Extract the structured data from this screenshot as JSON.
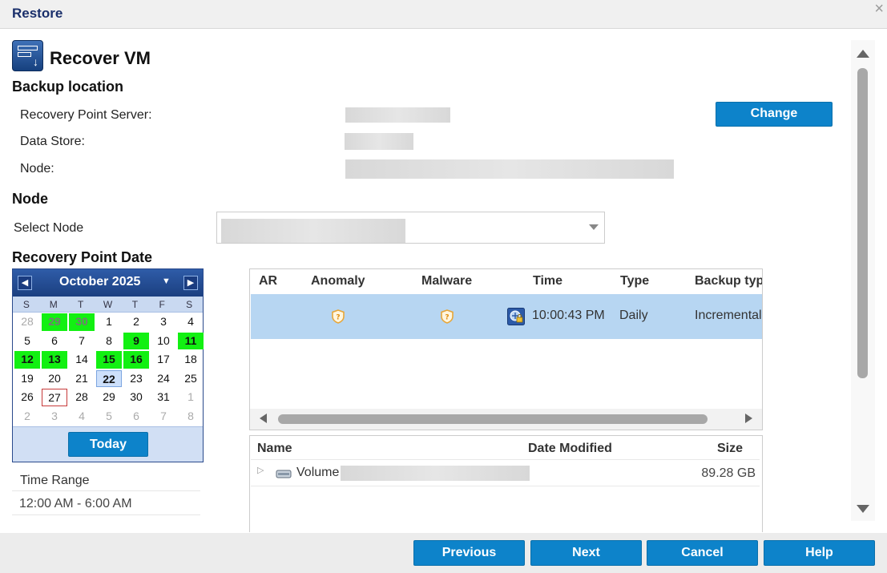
{
  "window": {
    "title": "Restore",
    "close_glyph": "×"
  },
  "header": {
    "title": "Recover VM",
    "icon": "recover-vm-icon"
  },
  "backup_location": {
    "heading": "Backup location",
    "rps_label": "Recovery Point Server:",
    "datastore_label": "Data Store:",
    "node_label": "Node:",
    "change_label": "Change"
  },
  "node": {
    "heading": "Node",
    "select_label": "Select Node"
  },
  "calendar": {
    "heading": "Recovery Point Date",
    "month": "October 2025",
    "prev_glyph": "◀",
    "next_glyph": "▶",
    "dropdown_glyph": "▼",
    "weekdays": [
      "S",
      "M",
      "T",
      "W",
      "T",
      "F",
      "S"
    ],
    "days": [
      {
        "d": "28",
        "cls": "o"
      },
      {
        "d": "29",
        "cls": "o g"
      },
      {
        "d": "30",
        "cls": "o g"
      },
      {
        "d": "1",
        "cls": ""
      },
      {
        "d": "2",
        "cls": ""
      },
      {
        "d": "3",
        "cls": ""
      },
      {
        "d": "4",
        "cls": ""
      },
      {
        "d": "5",
        "cls": ""
      },
      {
        "d": "6",
        "cls": ""
      },
      {
        "d": "7",
        "cls": ""
      },
      {
        "d": "8",
        "cls": ""
      },
      {
        "d": "9",
        "cls": "g"
      },
      {
        "d": "10",
        "cls": ""
      },
      {
        "d": "11",
        "cls": "g"
      },
      {
        "d": "12",
        "cls": "g"
      },
      {
        "d": "13",
        "cls": "g"
      },
      {
        "d": "14",
        "cls": ""
      },
      {
        "d": "15",
        "cls": "g"
      },
      {
        "d": "16",
        "cls": "g"
      },
      {
        "d": "17",
        "cls": ""
      },
      {
        "d": "18",
        "cls": ""
      },
      {
        "d": "19",
        "cls": ""
      },
      {
        "d": "20",
        "cls": ""
      },
      {
        "d": "21",
        "cls": ""
      },
      {
        "d": "22",
        "cls": "sel"
      },
      {
        "d": "23",
        "cls": ""
      },
      {
        "d": "24",
        "cls": ""
      },
      {
        "d": "25",
        "cls": ""
      },
      {
        "d": "26",
        "cls": ""
      },
      {
        "d": "27",
        "cls": "today"
      },
      {
        "d": "28",
        "cls": ""
      },
      {
        "d": "29",
        "cls": ""
      },
      {
        "d": "30",
        "cls": ""
      },
      {
        "d": "31",
        "cls": ""
      },
      {
        "d": "1",
        "cls": "o"
      },
      {
        "d": "2",
        "cls": "o"
      },
      {
        "d": "3",
        "cls": "o"
      },
      {
        "d": "4",
        "cls": "o"
      },
      {
        "d": "5",
        "cls": "o"
      },
      {
        "d": "6",
        "cls": "o"
      },
      {
        "d": "7",
        "cls": "o"
      },
      {
        "d": "8",
        "cls": "o"
      }
    ],
    "today_label": "Today",
    "highlight_color": "#12f012"
  },
  "time_range": {
    "label": "Time Range",
    "value": "12:00 AM - 6:00 AM"
  },
  "recovery_points": {
    "columns": [
      "AR",
      "Anomaly",
      "Malware",
      "Time",
      "Type",
      "Backup typ"
    ],
    "rows": [
      {
        "time": "10:00:43 PM",
        "type": "Daily",
        "backup_type": "Incremental",
        "anomaly_icon": "shield-question-icon",
        "malware_icon": "shield-question-icon",
        "time_icon": "encrypted-backup-icon"
      }
    ]
  },
  "files": {
    "columns": [
      "Name",
      "Date Modified",
      "Size"
    ],
    "rows": [
      {
        "name": "Volume",
        "size": "89.28 GB",
        "icon": "drive-icon"
      }
    ]
  },
  "footer": {
    "previous": "Previous",
    "next": "Next",
    "cancel": "Cancel",
    "help": "Help"
  }
}
